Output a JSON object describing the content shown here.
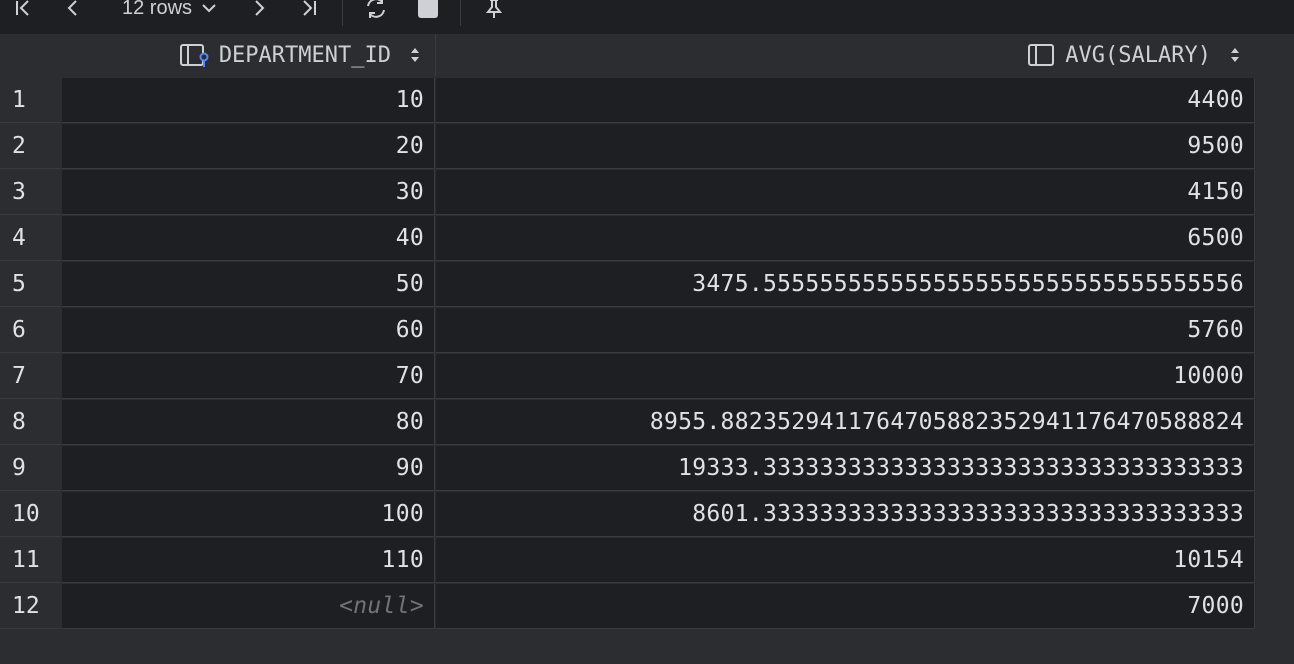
{
  "toolbar": {
    "rows_label": "12 rows"
  },
  "columns": [
    {
      "label": "DEPARTMENT_ID",
      "icon": "column-key-icon"
    },
    {
      "label": "AVG(SALARY)",
      "icon": "column-icon"
    }
  ],
  "rows": [
    {
      "num": "1",
      "dept": "10",
      "avg": "4400"
    },
    {
      "num": "2",
      "dept": "20",
      "avg": "9500"
    },
    {
      "num": "3",
      "dept": "30",
      "avg": "4150"
    },
    {
      "num": "4",
      "dept": "40",
      "avg": "6500"
    },
    {
      "num": "5",
      "dept": "50",
      "avg": "3475.5555555555555555555555555555555556"
    },
    {
      "num": "6",
      "dept": "60",
      "avg": "5760"
    },
    {
      "num": "7",
      "dept": "70",
      "avg": "10000"
    },
    {
      "num": "8",
      "dept": "80",
      "avg": "8955.8823529411764705882352941176470588824"
    },
    {
      "num": "9",
      "dept": "90",
      "avg": "19333.3333333333333333333333333333333333"
    },
    {
      "num": "10",
      "dept": "100",
      "avg": "8601.3333333333333333333333333333333333"
    },
    {
      "num": "11",
      "dept": "110",
      "avg": "10154"
    },
    {
      "num": "12",
      "dept": "<null>",
      "avg": "7000"
    }
  ],
  "colors": {
    "background": "#2b2d30",
    "cell_background": "#1e1f22",
    "text": "#dfe1e5",
    "null_text": "#6f737a",
    "key_accent": "#548af7"
  }
}
